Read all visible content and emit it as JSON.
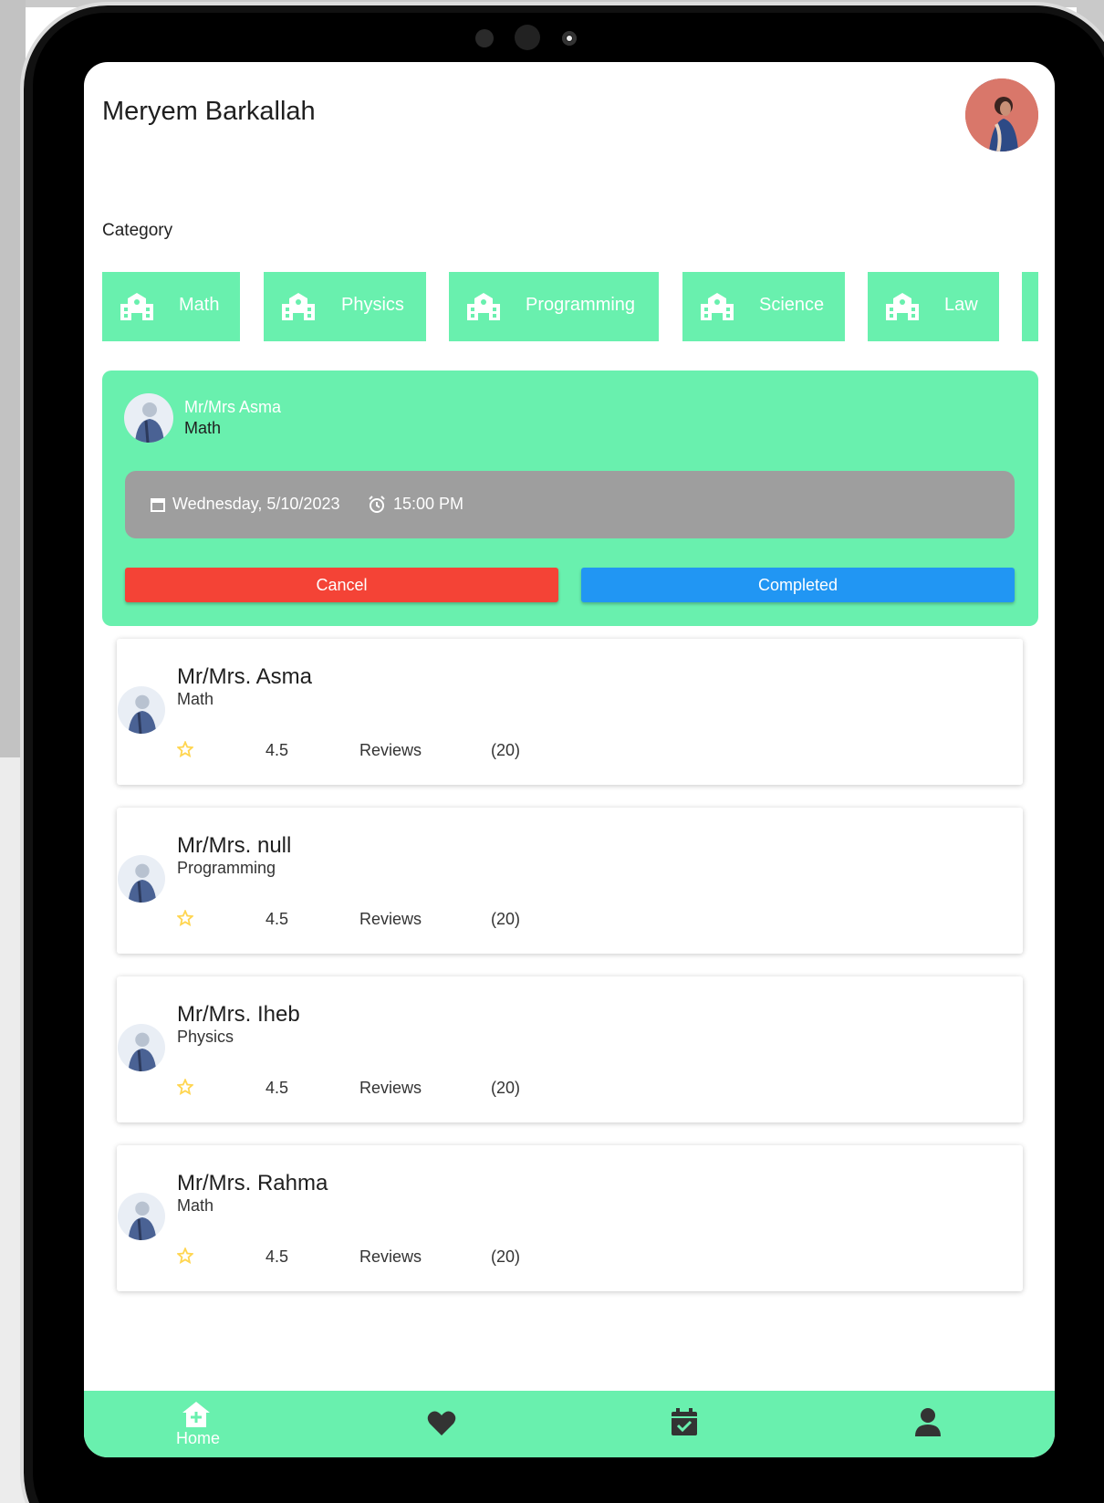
{
  "header": {
    "user_name": "Meryem Barkallah"
  },
  "category": {
    "title": "Category",
    "items": [
      {
        "label": "Math",
        "icon": "school-icon"
      },
      {
        "label": "Physics",
        "icon": "school-icon"
      },
      {
        "label": "Programming",
        "icon": "school-icon"
      },
      {
        "label": "Science",
        "icon": "school-icon"
      },
      {
        "label": "Law",
        "icon": "school-icon"
      }
    ]
  },
  "appointment": {
    "teacher": "Mr/Mrs Asma",
    "subject": "Math",
    "date": "Wednesday, 5/10/2023",
    "time": "15:00 PM",
    "cancel_label": "Cancel",
    "completed_label": "Completed"
  },
  "teachers": [
    {
      "name": "Mr/Mrs. Asma",
      "subject": "Math",
      "rating": "4.5",
      "reviews_label": "Reviews",
      "reviews_count": "(20)"
    },
    {
      "name": "Mr/Mrs. null",
      "subject": "Programming",
      "rating": "4.5",
      "reviews_label": "Reviews",
      "reviews_count": "(20)"
    },
    {
      "name": "Mr/Mrs. Iheb",
      "subject": "Physics",
      "rating": "4.5",
      "reviews_label": "Reviews",
      "reviews_count": "(20)"
    },
    {
      "name": "Mr/Mrs. Rahma",
      "subject": "Math",
      "rating": "4.5",
      "reviews_label": "Reviews",
      "reviews_count": "(20)"
    }
  ],
  "bottom_nav": {
    "home_label": "Home",
    "items": [
      "home-add-icon",
      "heart-icon",
      "calendar-check-icon",
      "person-icon"
    ]
  },
  "colors": {
    "accent": "#69f0ae",
    "cancel": "#f44336",
    "completed": "#2196f3",
    "date_bar": "#9e9e9e",
    "star": "#ffd54f"
  }
}
